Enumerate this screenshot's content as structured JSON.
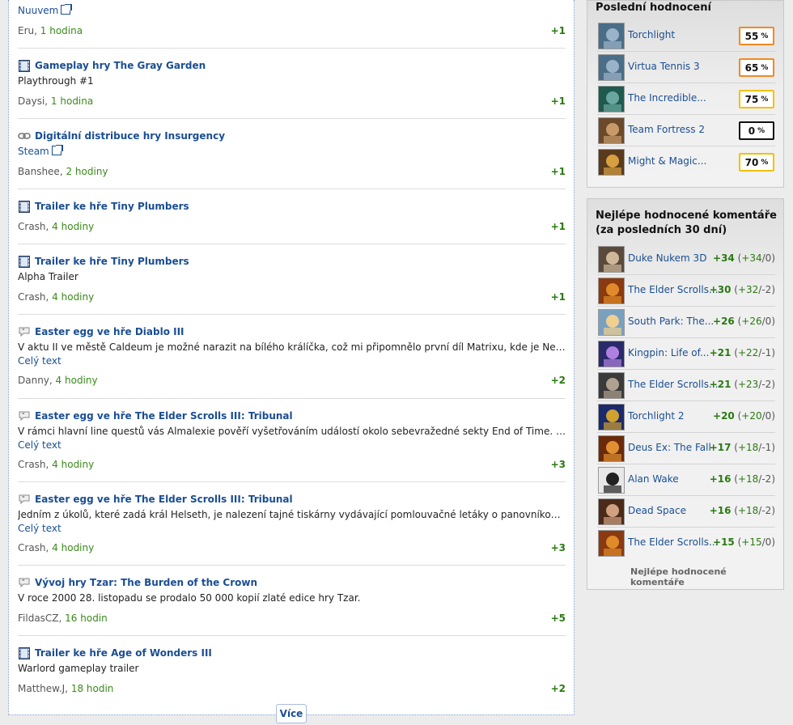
{
  "feed": {
    "items": [
      {
        "type": "link",
        "title": "",
        "line1": "Nuuvem",
        "line1_is_link": true,
        "line2": "",
        "user": "Eru",
        "time": "1 hodina",
        "score": "+1"
      },
      {
        "type": "video",
        "title": "Gameplay hry The Gray Garden",
        "line1": "Playthrough #1",
        "line1_is_link": false,
        "line2": "",
        "user": "Daysi",
        "time": "1 hodina",
        "score": "+1"
      },
      {
        "type": "link",
        "title": "Digitální distribuce hry Insurgency",
        "line1": "Steam",
        "line1_is_link": true,
        "line2": "",
        "user": "Banshee",
        "time": "2 hodiny",
        "score": "+1"
      },
      {
        "type": "video",
        "title": "Trailer ke hře Tiny Plumbers",
        "line1": "",
        "line1_is_link": false,
        "line2": "",
        "user": "Crash",
        "time": "4 hodiny",
        "score": "+1"
      },
      {
        "type": "video",
        "title": "Trailer ke hře Tiny Plumbers",
        "line1": "Alpha Trailer",
        "line1_is_link": false,
        "line2": "",
        "user": "Crash",
        "time": "4 hodiny",
        "score": "+1"
      },
      {
        "type": "quote",
        "title": "Easter egg ve hře Diablo III",
        "line1": "V aktu II ve městě Caldeum je možné narazit na bílého králíčka, což mi připomnělo první díl Matrixu, kde je Neovi řečeno: \"Follow the white rabbit\"...",
        "line1_is_link": false,
        "line2": "Celý text",
        "user": "Danny",
        "time": "4 hodiny",
        "score": "+2"
      },
      {
        "type": "quote",
        "title": "Easter egg ve hře The Elder Scrolls III: Tribunal",
        "line1": "V rámci hlavní line questů vás Almalexie pověří vyšetřováním událostí okolo sebevražedné sekty End of Time. Jejím vůdcem je ...",
        "line1_is_link": false,
        "line2": "Celý text",
        "user": "Crash",
        "time": "4 hodiny",
        "score": "+3"
      },
      {
        "type": "quote",
        "title": "Easter egg ve hře The Elder Scrolls III: Tribunal",
        "line1": "Jedním z úkolů, které zadá král Helseth, je nalezení tajné tiskárny vydávající pomlouvačné letáky o panovníkovi. Když jí objevíte ...",
        "line1_is_link": false,
        "line2": "Celý text",
        "user": "Crash",
        "time": "4 hodiny",
        "score": "+3"
      },
      {
        "type": "quote",
        "title": "Vývoj hry Tzar: The Burden of the Crown",
        "line1": "V roce 2000 28. listopadu se prodalo 50 000 kopií zlaté edice hry Tzar.",
        "line1_is_link": false,
        "line2": "",
        "user": "FildasCZ",
        "time": "16 hodin",
        "score": "+5"
      },
      {
        "type": "video",
        "title": "Trailer ke hře Age of Wonders III",
        "line1": "Warlord gameplay trailer",
        "line1_is_link": false,
        "line2": "",
        "user": "Matthew.J",
        "time": "18 hodin",
        "score": "+2"
      }
    ],
    "more_label": "Více"
  },
  "ratings": {
    "title": "Poslední hodnocení",
    "rows": [
      {
        "name": "Torchlight",
        "value": "55",
        "unit": "%",
        "border": "#f08a24",
        "thumb": [
          "#4a6d88",
          "#9bb3c9"
        ]
      },
      {
        "name": "Virtua Tennis 3",
        "value": "65",
        "unit": "%",
        "border": "#f08a24",
        "thumb": [
          "#4a6d88",
          "#9bb3c9"
        ]
      },
      {
        "name": "The Incredible...",
        "value": "75",
        "unit": "%",
        "border": "#f5c000",
        "thumb": [
          "#1f5a4e",
          "#6aa6a0"
        ]
      },
      {
        "name": "Team Fortress 2",
        "value": "0",
        "unit": "%",
        "border": "#111111",
        "thumb": [
          "#6b4a2c",
          "#c89a6a"
        ]
      },
      {
        "name": "Might & Magic...",
        "value": "70",
        "unit": "%",
        "border": "#f5c000",
        "thumb": [
          "#5a3a1c",
          "#d6a040"
        ]
      }
    ]
  },
  "top_comments": {
    "title_line1": "Nejlépe hodnocené komentáře",
    "title_line2": "(za posledních 30 dní)",
    "rows": [
      {
        "name": "Duke Nukem 3D",
        "total": "+34",
        "pos": "+34",
        "neg": "0",
        "thumb": [
          "#5a4a3c",
          "#cfb79a"
        ]
      },
      {
        "name": "The Elder Scrolls...",
        "total": "+30",
        "pos": "+32",
        "neg": "-2",
        "thumb": [
          "#8a3a10",
          "#e08a2a"
        ]
      },
      {
        "name": "South Park: The...",
        "total": "+26",
        "pos": "+26",
        "neg": "0",
        "thumb": [
          "#7aa0c0",
          "#f0d090"
        ]
      },
      {
        "name": "Kingpin: Life of...",
        "total": "+21",
        "pos": "+22",
        "neg": "-1",
        "thumb": [
          "#2a2a6a",
          "#b080e0"
        ]
      },
      {
        "name": "The Elder Scrolls...",
        "total": "+21",
        "pos": "+23",
        "neg": "-2",
        "thumb": [
          "#3a3a3a",
          "#b0a090"
        ]
      },
      {
        "name": "Torchlight 2",
        "total": "+20",
        "pos": "+20",
        "neg": "0",
        "thumb": [
          "#1a2a6a",
          "#d0a030"
        ]
      },
      {
        "name": "Deus Ex: The Fall",
        "total": "+17",
        "pos": "+18",
        "neg": "-1",
        "thumb": [
          "#6a2a0a",
          "#e09030"
        ]
      },
      {
        "name": "Alan Wake",
        "total": "+16",
        "pos": "+18",
        "neg": "-2",
        "thumb": [
          "#e8e8e8",
          "#222222"
        ]
      },
      {
        "name": "Dead Space",
        "total": "+16",
        "pos": "+18",
        "neg": "-2",
        "thumb": [
          "#4a2a1a",
          "#d0a080"
        ]
      },
      {
        "name": "The Elder Scrolls...",
        "total": "+15",
        "pos": "+15",
        "neg": "0",
        "thumb": [
          "#8a3a10",
          "#e08a2a"
        ]
      }
    ],
    "footer_link": "Nejlépe hodnocené komentáře"
  }
}
